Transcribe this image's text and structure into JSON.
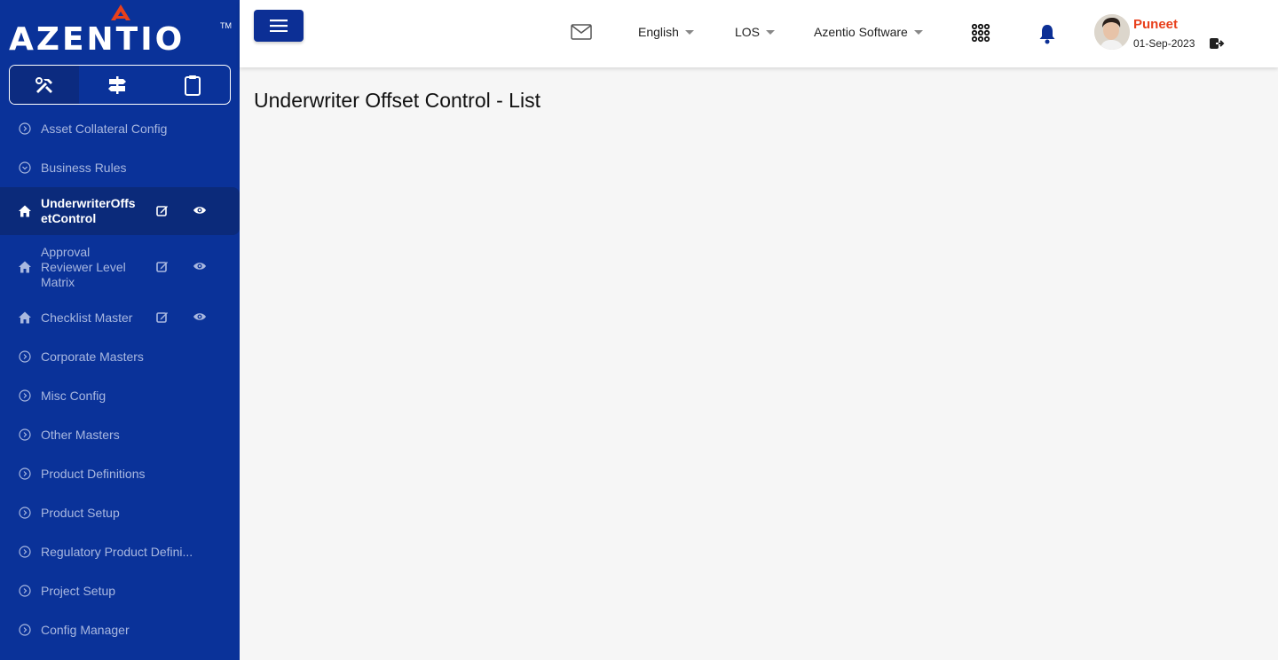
{
  "brand": {
    "name": "AZENTIO",
    "tm": "TM"
  },
  "colors": {
    "sidebar": "#0a3299",
    "accent": "#e8401c",
    "button": "#0c2f95"
  },
  "mode_tabs": [
    {
      "icon": "tools-icon",
      "active": true
    },
    {
      "icon": "signpost-icon",
      "active": false
    },
    {
      "icon": "clipboard-icon",
      "active": false
    }
  ],
  "nav": {
    "items": [
      {
        "label": "Asset Collateral Config"
      },
      {
        "label": "Business Rules"
      },
      {
        "label": "UnderwriterOffsetControl"
      },
      {
        "label": "Approval Reviewer Level Matrix"
      },
      {
        "label": "Checklist Master"
      },
      {
        "label": "Corporate Masters"
      },
      {
        "label": "Misc Config"
      },
      {
        "label": "Other Masters"
      },
      {
        "label": "Product Definitions"
      },
      {
        "label": "Product Setup"
      },
      {
        "label": "Regulatory Product Defini..."
      },
      {
        "label": "Project Setup"
      },
      {
        "label": "Config Manager"
      }
    ]
  },
  "header": {
    "language": "English",
    "module": "LOS",
    "organization": "Azentio Software",
    "user": {
      "name": "Puneet",
      "date": "01-Sep-2023"
    }
  },
  "page": {
    "title": "Underwriter Offset Control - List"
  }
}
